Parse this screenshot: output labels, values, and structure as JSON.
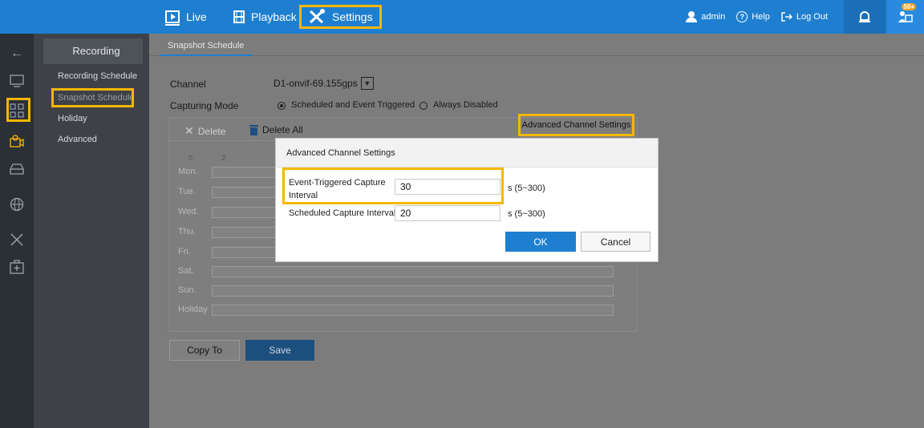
{
  "topnav": {
    "live_label": "Live",
    "playback_label": "Playback",
    "settings_label": "Settings",
    "user_label": "admin",
    "help_label": "Help",
    "logout_label": "Log Out",
    "notification_badge": "50+"
  },
  "colors": {
    "topbar": "#1e7fd0",
    "highlight": "#f5b700",
    "rail": "#2b2f36"
  },
  "rail": {
    "icons": [
      "back-arrow-icon",
      "monitor-icon",
      "camera-group-icon",
      "recording-icon",
      "storage-icon",
      "network-icon",
      "tools-icon",
      "maintenance-icon"
    ]
  },
  "subnav": {
    "title": "Recording",
    "items": [
      "Recording Schedule",
      "Snapshot Schedule",
      "Holiday",
      "Advanced"
    ]
  },
  "tabs": {
    "active": "Snapshot Schedule"
  },
  "form": {
    "channel_label": "Channel",
    "channel_value": "D1-onvif-69.155gps",
    "capturing_mode_label": "Capturing Mode",
    "mode_option_1": "Scheduled and Event Triggered",
    "mode_option_2": "Always Disabled"
  },
  "toolbar": {
    "delete_label": "Delete",
    "delete_all_label": "Delete All",
    "advanced_label": "Advanced Channel Settings"
  },
  "schedule": {
    "hours": [
      "0",
      "2"
    ],
    "days": [
      "Mon.",
      "Tue.",
      "Wed.",
      "Thu.",
      "Fri.",
      "Sat.",
      "Sun.",
      "Holiday"
    ]
  },
  "bottom": {
    "copy_label": "Copy To",
    "save_label": "Save"
  },
  "modal": {
    "title": "Advanced Channel Settings",
    "event_label": "Event-Triggered Capture Interval",
    "event_value": "30",
    "event_range": "s  (5~300)",
    "scheduled_label": "Scheduled Capture Interval",
    "scheduled_value": "20",
    "scheduled_range": "s  (5~300)",
    "ok_label": "OK",
    "cancel_label": "Cancel"
  }
}
